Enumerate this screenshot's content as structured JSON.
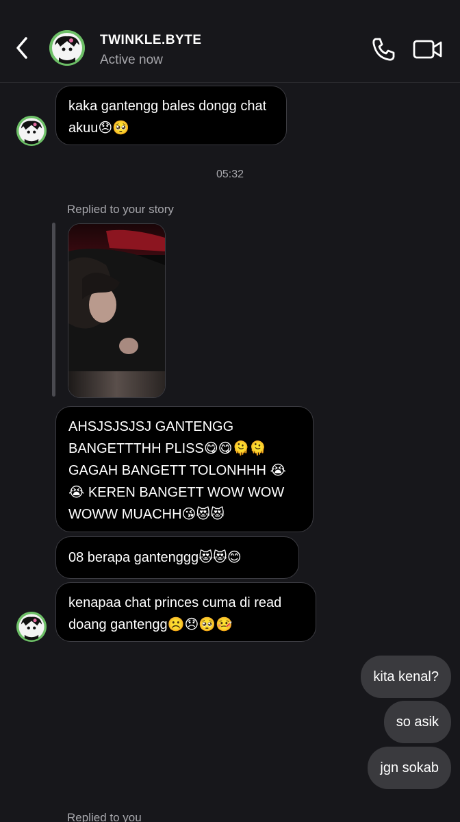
{
  "header": {
    "title": "TWINKLE.BYTE",
    "status": "Active now",
    "back_icon": "chevron-left-icon",
    "call_icon": "phone-icon",
    "video_icon": "video-camera-icon"
  },
  "messages_in": [
    {
      "text": "kaka gantengg bales dongg chat akuu😞🥺"
    },
    {
      "text": "AHSJSJSJSJ GANTENGG BANGETTTHH PLISS😋😋🫠🫠 GAGAH BANGETT TOLONHHH 😭😭 KEREN BANGETT WOW WOW WOWW MUACHH😘😻😻"
    },
    {
      "text": "08 berapa gantenggg😻😻😊"
    },
    {
      "text": "kenapaa chat princes cuma di read doang gantengg☹️😞🥺🤒"
    }
  ],
  "timestamp": "05:32",
  "story_reply_label": "Replied to your story",
  "messages_out": [
    {
      "text": "kita kenal?"
    },
    {
      "text": "so asik"
    },
    {
      "text": "jgn sokab"
    }
  ],
  "bottom_label": "Replied to you",
  "colors": {
    "background": "#17171b",
    "incoming_bubble": "#000000",
    "outgoing_bubble": "#3a3a3e",
    "avatar_ring": "#6dbf67",
    "muted_text": "#a8a8ad"
  }
}
